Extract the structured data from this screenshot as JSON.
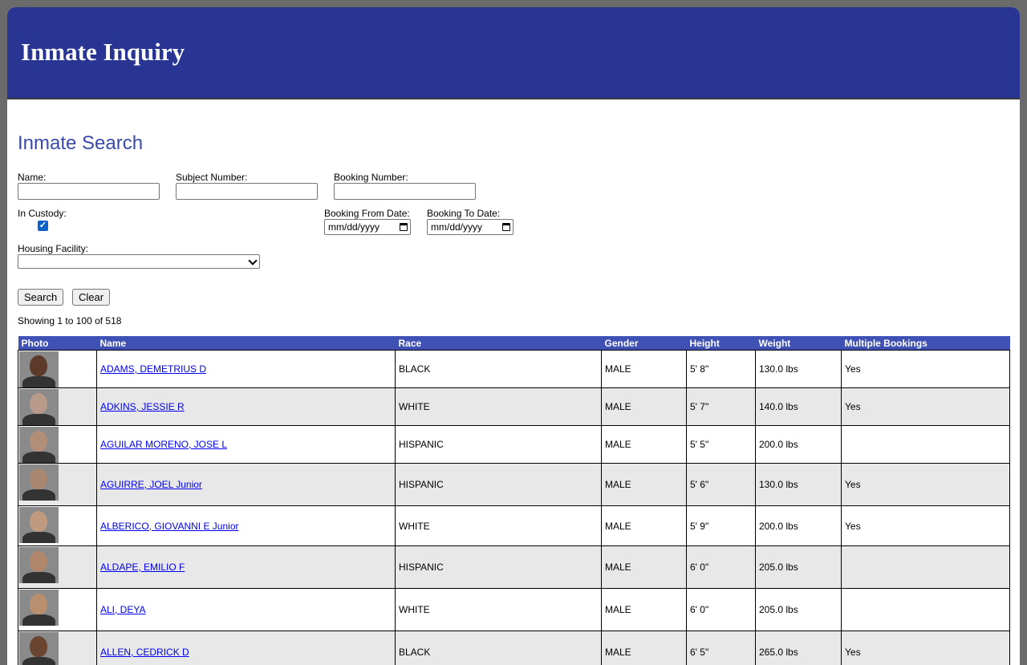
{
  "header": {
    "title": "Inmate Inquiry"
  },
  "search": {
    "title": "Inmate Search",
    "name_label": "Name:",
    "subject_label": "Subject Number:",
    "booking_label": "Booking Number:",
    "in_custody_label": "In Custody:",
    "in_custody_checked": true,
    "booking_from_label": "Booking From Date:",
    "booking_to_label": "Booking To Date:",
    "date_placeholder": "mm/dd/yyyy",
    "housing_label": "Housing Facility:",
    "search_button": "Search",
    "clear_button": "Clear"
  },
  "results": {
    "count_text": "Showing 1 to 100 of 518",
    "columns": [
      "Photo",
      "Name",
      "Race",
      "Gender",
      "Height",
      "Weight",
      "Multiple Bookings"
    ],
    "rows": [
      {
        "name": "ADAMS, DEMETRIUS D",
        "race": "BLACK",
        "gender": "MALE",
        "height": "5' 8\"",
        "weight": "130.0 lbs",
        "multiple": "Yes",
        "skin": "#5b3a29"
      },
      {
        "name": "ADKINS, JESSIE R",
        "race": "WHITE",
        "gender": "MALE",
        "height": "5' 7\"",
        "weight": "140.0 lbs",
        "multiple": "Yes",
        "skin": "#b89a8a"
      },
      {
        "name": "AGUILAR MORENO, JOSE L",
        "race": "HISPANIC",
        "gender": "MALE",
        "height": "5' 5\"",
        "weight": "200.0 lbs",
        "multiple": "",
        "skin": "#b08e78"
      },
      {
        "name": "AGUIRRE, JOEL Junior",
        "race": "HISPANIC",
        "gender": "MALE",
        "height": "5' 6\"",
        "weight": "130.0 lbs",
        "multiple": "Yes",
        "skin": "#a88670"
      },
      {
        "name": "ALBERICO, GIOVANNI E Junior",
        "race": "WHITE",
        "gender": "MALE",
        "height": "5' 9\"",
        "weight": "200.0 lbs",
        "multiple": "Yes",
        "skin": "#c09a80"
      },
      {
        "name": "ALDAPE, EMILIO F",
        "race": "HISPANIC",
        "gender": "MALE",
        "height": "6' 0\"",
        "weight": "205.0 lbs",
        "multiple": "",
        "skin": "#b0876a"
      },
      {
        "name": "ALI, DEYA",
        "race": "WHITE",
        "gender": "MALE",
        "height": "6' 0\"",
        "weight": "205.0 lbs",
        "multiple": "",
        "skin": "#b89070"
      },
      {
        "name": "ALLEN, CEDRICK D",
        "race": "BLACK",
        "gender": "MALE",
        "height": "6' 5\"",
        "weight": "265.0 lbs",
        "multiple": "Yes",
        "skin": "#6a4532"
      }
    ]
  }
}
